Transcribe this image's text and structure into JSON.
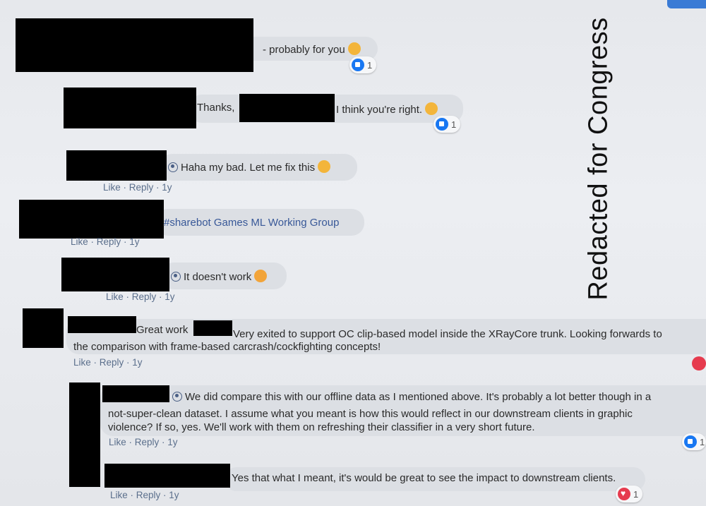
{
  "watermark": "Redacted for Congress",
  "comments": [
    {
      "text": "- probably for you",
      "reaction_count": "1"
    },
    {
      "text_a": "Thanks,",
      "text_b": "I think you're right.",
      "reaction_count": "1"
    },
    {
      "text": "Haha my bad. Let me fix this",
      "meta": {
        "like": "Like",
        "reply": "Reply",
        "age": "1y"
      }
    },
    {
      "text": "#sharebot Games ML Working Group",
      "meta": {
        "like": "Like",
        "reply": "Reply",
        "age": "1y"
      }
    },
    {
      "text": "It doesn't work",
      "meta": {
        "like": "Like",
        "reply": "Reply",
        "age": "1y"
      }
    },
    {
      "text_a": "Great work",
      "text_b": "Very exited to support OC clip-based model inside the XRayCore trunk. Looking forwards to",
      "text_c": "the comparison with frame-based carcrash/cockfighting concepts!",
      "meta": {
        "like": "Like",
        "reply": "Reply",
        "age": "1y"
      }
    },
    {
      "line1": "We did compare this with our offline data as I mentioned above. It's probably a lot better though in a",
      "line2": "not-super-clean dataset. I assume what you meant is how this would reflect in our downstream clients in graphic",
      "line3": "violence? If so, yes. We'll work with them on refreshing their classifier in a very short future.",
      "meta": {
        "like": "Like",
        "reply": "Reply",
        "age": "1y"
      },
      "reaction_count": "1"
    },
    {
      "text": "Yes that what I meant, it's would be great to see the impact to downstream clients.",
      "meta": {
        "like": "Like",
        "reply": "Reply",
        "age": "1y"
      },
      "reaction_count": "1"
    }
  ],
  "colors": {
    "like_blue": "#1877f2",
    "love_red": "#e63b4e",
    "link": "#385898",
    "meta": "#5b6f8c"
  },
  "icons": [
    "like-reaction-icon",
    "love-reaction-icon",
    "user-badge-icon",
    "smile-emoji-icon",
    "sad-emoji-icon"
  ]
}
